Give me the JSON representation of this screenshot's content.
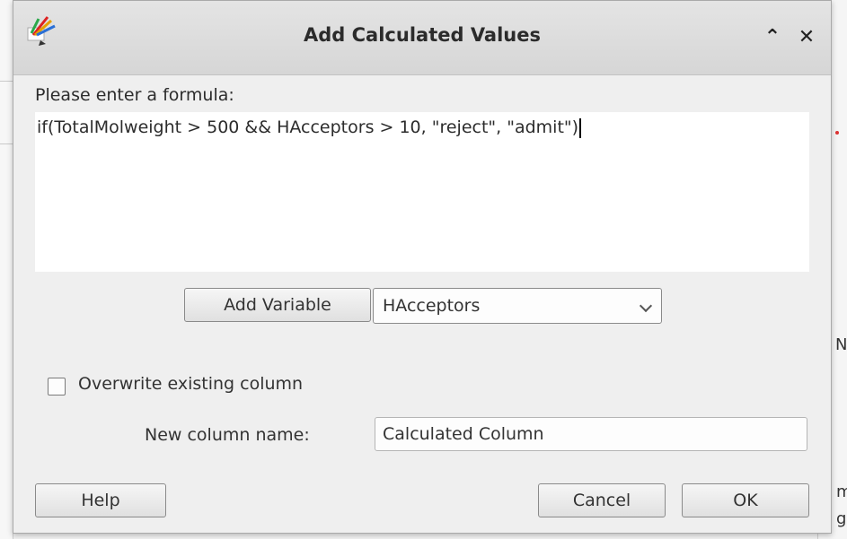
{
  "dialog": {
    "title": "Add Calculated Values",
    "prompt": "Please enter a formula:",
    "formula": "if(TotalMolweight > 500 && HAcceptors > 10, \"reject\", \"admit\")",
    "add_variable_label": "Add Variable",
    "variable_selected": "HAcceptors",
    "overwrite_label": "Overwrite existing column",
    "overwrite_checked": false,
    "new_column_label": "New column name:",
    "new_column_value": "Calculated Column",
    "help_label": "Help",
    "cancel_label": "Cancel",
    "ok_label": "OK"
  },
  "titlebar_controls": {
    "collapse_icon": "chevron-up-icon",
    "close_icon": "close-icon",
    "app_icon": "datawarrior-app-icon"
  },
  "background_fragments": {
    "right_letters": [
      "N",
      "m",
      "g"
    ]
  }
}
